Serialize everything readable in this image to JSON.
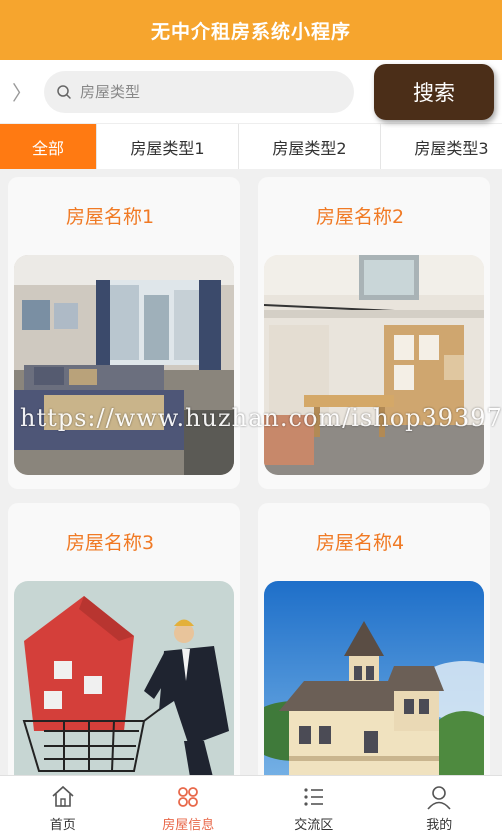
{
  "app": {
    "title": "无中介租房系统小程序"
  },
  "search": {
    "placeholder": "房屋类型",
    "button": "搜索"
  },
  "tabs": [
    {
      "label": "全部",
      "active": true
    },
    {
      "label": "房屋类型1"
    },
    {
      "label": "房屋类型2"
    },
    {
      "label": "房屋类型3"
    }
  ],
  "houses": [
    {
      "name": "房屋名称1",
      "image": "bedroom-photo"
    },
    {
      "name": "房屋名称2",
      "image": "loft-photo"
    },
    {
      "name": "房屋名称3",
      "image": "house-cart-illustration"
    },
    {
      "name": "房屋名称4",
      "image": "victorian-house-photo"
    }
  ],
  "watermark": "https://www.huzhan.com/ishop39397",
  "nav": [
    {
      "label": "首页",
      "icon": "home-icon"
    },
    {
      "label": "房屋信息",
      "icon": "grid-icon",
      "active": true
    },
    {
      "label": "交流区",
      "icon": "list-icon"
    },
    {
      "label": "我的",
      "icon": "user-icon"
    }
  ],
  "colors": {
    "header": "#f6a52e",
    "accent": "#ff7a12",
    "search_button": "#4b2e18",
    "card_title": "#f07a25",
    "nav_active": "#e8684a"
  }
}
